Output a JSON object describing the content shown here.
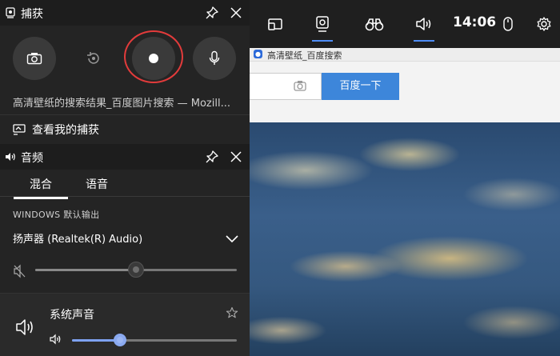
{
  "capture": {
    "title": "捕获",
    "source_text": "高清壁纸的搜索结果_百度图片搜索 — Mozill...",
    "see_captures_label": "查看我的捕获"
  },
  "audio": {
    "title": "音频",
    "tabs": [
      "混合",
      "语音"
    ],
    "active_tab": "混合",
    "section_label": "WINDOWS 默认输出",
    "device": "扬声器 (Realtek(R) Audio)",
    "master_volume_percent": 50,
    "apps": [
      {
        "name": "系统声音",
        "volume_percent": 29
      }
    ]
  },
  "gamebar": {
    "clock": "14:06",
    "buttons": [
      {
        "name": "widget-menu",
        "active": false
      },
      {
        "name": "capture",
        "active": true
      },
      {
        "name": "looking-for-group",
        "active": false
      },
      {
        "name": "audio",
        "active": true
      },
      {
        "name": "mouse",
        "active": false
      },
      {
        "name": "settings",
        "active": false
      }
    ]
  },
  "browser": {
    "tab_title": "高清壁纸_百度搜索",
    "search_button": "百度一下"
  },
  "colors": {
    "record_ring": "#e23b3b",
    "accent_blue": "#4f8ef7",
    "slider_blue": "#7ea2f2",
    "baidu_blue": "#3d86da"
  }
}
